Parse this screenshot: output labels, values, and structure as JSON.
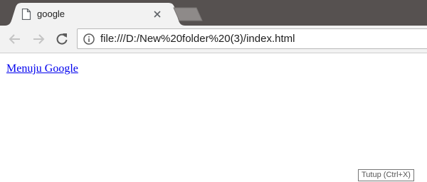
{
  "tab": {
    "title": "google"
  },
  "toolbar": {
    "url": "file:///D:/New%20folder%20(3)/index.html"
  },
  "page": {
    "link_text": "Menuju Google"
  },
  "tooltip": {
    "text": "Tutup (Ctrl+X)"
  },
  "colors": {
    "tabstrip": "#565150",
    "toolbar": "#f2f2f2",
    "link": "#0000ee"
  },
  "icons": {
    "tab_favicon": "page-icon",
    "tab_close": "close-icon",
    "new_tab": "new-tab-icon",
    "back": "back-arrow-icon",
    "forward": "forward-arrow-icon",
    "reload": "reload-icon",
    "site_info": "info-icon"
  }
}
